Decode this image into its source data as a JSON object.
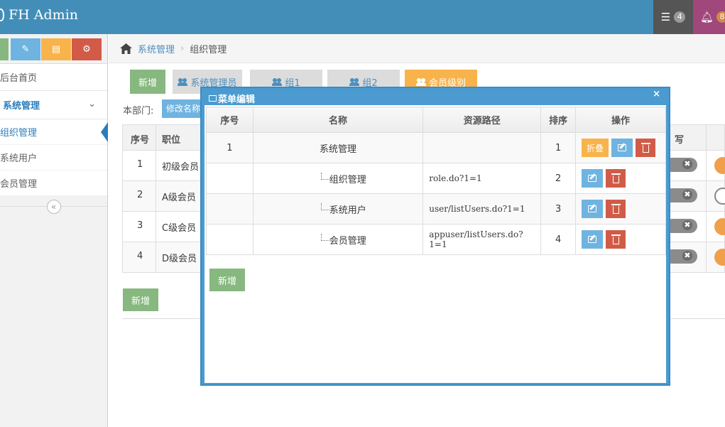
{
  "navbar": {
    "brand": "FH Admin",
    "tasks_count": "4",
    "notify_count": "8"
  },
  "sidebar": {
    "items": [
      {
        "label": "后台首页"
      },
      {
        "label": "系统管理"
      }
    ],
    "subitems": [
      {
        "label": "组织管理"
      },
      {
        "label": "系统用户"
      },
      {
        "label": "会员管理"
      }
    ],
    "collapse_glyph": "«"
  },
  "breadcrumb": {
    "parent": "系统管理",
    "separator": "›",
    "current": "组织管理"
  },
  "toolbar": {
    "add_label": "新增",
    "tabs": [
      {
        "label": "系统管理员"
      },
      {
        "label": "组1"
      },
      {
        "label": "组2"
      },
      {
        "label": "会员级别"
      }
    ]
  },
  "dept": {
    "label": "本部门:",
    "button": "修改名称"
  },
  "bg_table": {
    "headers": [
      "序号",
      "职位",
      "写"
    ],
    "rows": [
      {
        "no": "1",
        "name": "初级会员"
      },
      {
        "no": "2",
        "name": "A级会员"
      },
      {
        "no": "3",
        "name": "C级会员"
      },
      {
        "no": "4",
        "name": "D级会员"
      }
    ],
    "add_label": "新增"
  },
  "modal": {
    "title": "菜单编辑",
    "close": "×",
    "headers": [
      "序号",
      "名称",
      "资源路径",
      "排序",
      "操作"
    ],
    "rows": [
      {
        "no": "1",
        "name": "系统管理",
        "path": "",
        "order": "1",
        "collapse": "折叠"
      },
      {
        "no": "",
        "name": "组织管理",
        "path": "role.do?1=1",
        "order": "2"
      },
      {
        "no": "",
        "name": "系统用户",
        "path": "user/listUsers.do?1=1",
        "order": "3"
      },
      {
        "no": "",
        "name": "会员管理",
        "path": "appuser/listUsers.do?1=1",
        "order": "4"
      }
    ],
    "add_label": "新增"
  }
}
